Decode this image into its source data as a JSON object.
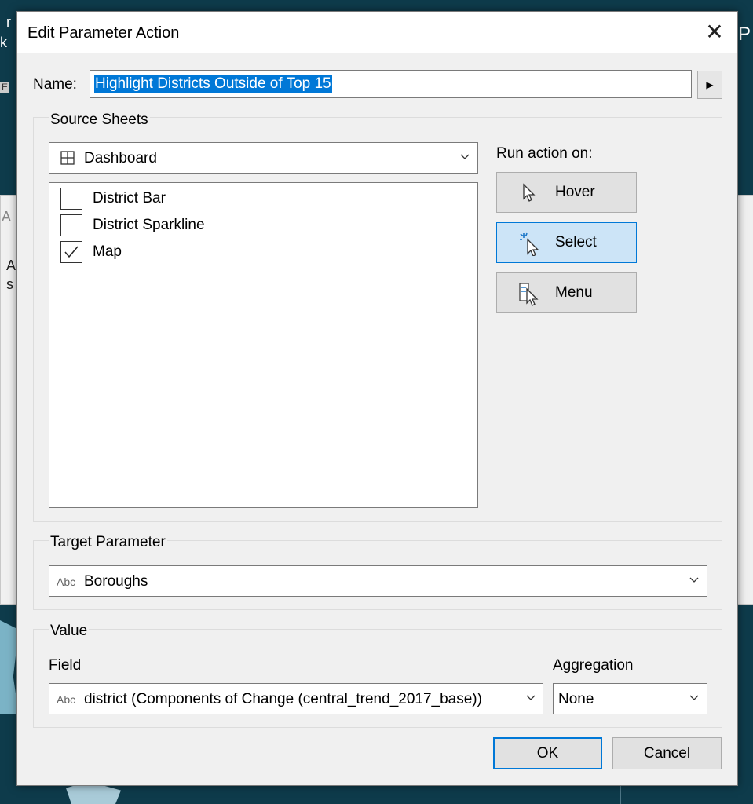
{
  "dialog": {
    "title": "Edit Parameter Action",
    "close_glyph": "✕"
  },
  "name": {
    "label": "Name:",
    "value": "Highlight Districts Outside of Top 15",
    "arrow_glyph": "▶"
  },
  "source_sheets": {
    "group_label": "Source Sheets",
    "selected_sheet": "Dashboard",
    "sheet_icon": "grid-icon",
    "items": [
      {
        "label": "District Bar",
        "checked": false
      },
      {
        "label": "District Sparkline",
        "checked": false
      },
      {
        "label": "Map",
        "checked": true
      }
    ]
  },
  "run_action": {
    "label": "Run action on:",
    "options": [
      {
        "label": "Hover",
        "icon": "cursor-icon",
        "selected": false
      },
      {
        "label": "Select",
        "icon": "cursor-click-icon",
        "selected": true
      },
      {
        "label": "Menu",
        "icon": "cursor-menu-icon",
        "selected": false
      }
    ]
  },
  "target_parameter": {
    "group_label": "Target Parameter",
    "type_badge": "Abc",
    "value": "Boroughs"
  },
  "value": {
    "group_label": "Value",
    "field_label": "Field",
    "field_type_badge": "Abc",
    "field_value": "district (Components of Change (central_trend_2017_base))",
    "aggregation_label": "Aggregation",
    "aggregation_value": "None"
  },
  "buttons": {
    "ok": "OK",
    "cancel": "Cancel"
  },
  "background": {
    "fragments": [
      "r",
      "k",
      "E",
      "P",
      "A",
      "A",
      "s"
    ]
  },
  "colors": {
    "accent": "#0078d7",
    "selected_button_bg": "#cce4f7",
    "dialog_bg": "#f0f0f0",
    "backdrop": "#0e3b4b"
  }
}
